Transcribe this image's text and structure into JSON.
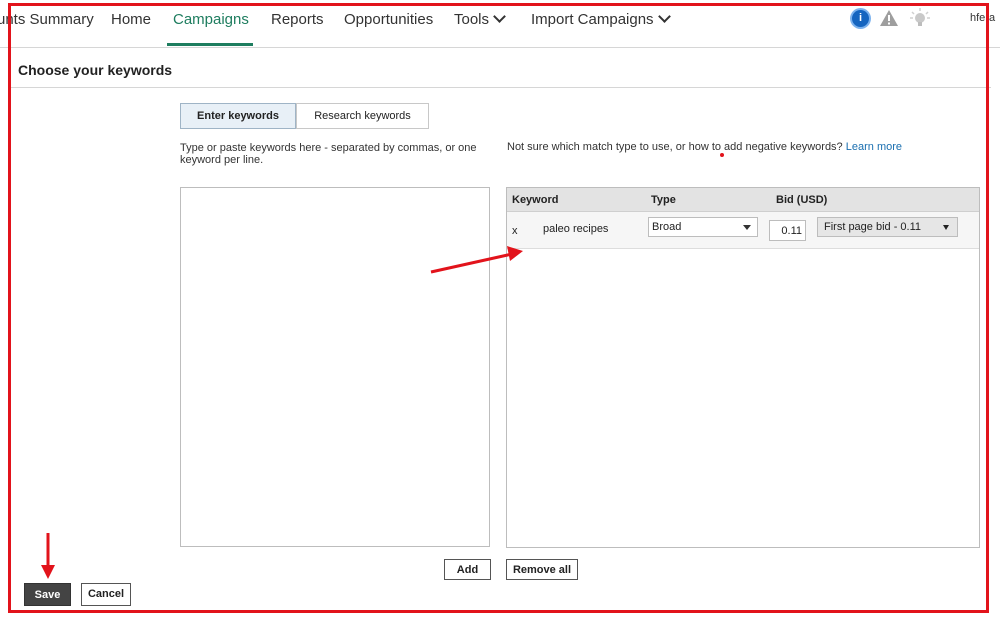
{
  "nav": {
    "items": [
      {
        "label": "unts Summary"
      },
      {
        "label": "Home"
      },
      {
        "label": "Campaigns"
      },
      {
        "label": "Reports"
      },
      {
        "label": "Opportunities"
      },
      {
        "label": "Tools"
      },
      {
        "label": "Import Campaigns"
      }
    ],
    "active": "Campaigns",
    "user": "hfera",
    "icons": [
      "info-icon",
      "warning-icon",
      "lightbulb-icon"
    ],
    "accent_color": "#1e7d5f"
  },
  "page": {
    "title": "Choose your keywords"
  },
  "tabs": [
    {
      "label": "Enter keywords",
      "selected": true
    },
    {
      "label": "Research keywords",
      "selected": false
    }
  ],
  "help": {
    "left": "Type or paste keywords here - separated by commas, or one keyword per line.",
    "right": "Not sure which match type to use, or how to add negative keywords?",
    "link": "Learn more"
  },
  "textarea": {
    "value": ""
  },
  "table": {
    "headers": {
      "keyword": "Keyword",
      "type": "Type",
      "bid": "Bid (USD)"
    },
    "rows": [
      {
        "remove": "x",
        "keyword": "paleo recipes",
        "type": "Broad",
        "bid": "0.11",
        "bid_option": "First page bid - 0.11"
      }
    ]
  },
  "buttons": {
    "add": "Add",
    "remove_all": "Remove all",
    "save": "Save",
    "cancel": "Cancel"
  },
  "annotation": {
    "color": "#e2131b"
  }
}
